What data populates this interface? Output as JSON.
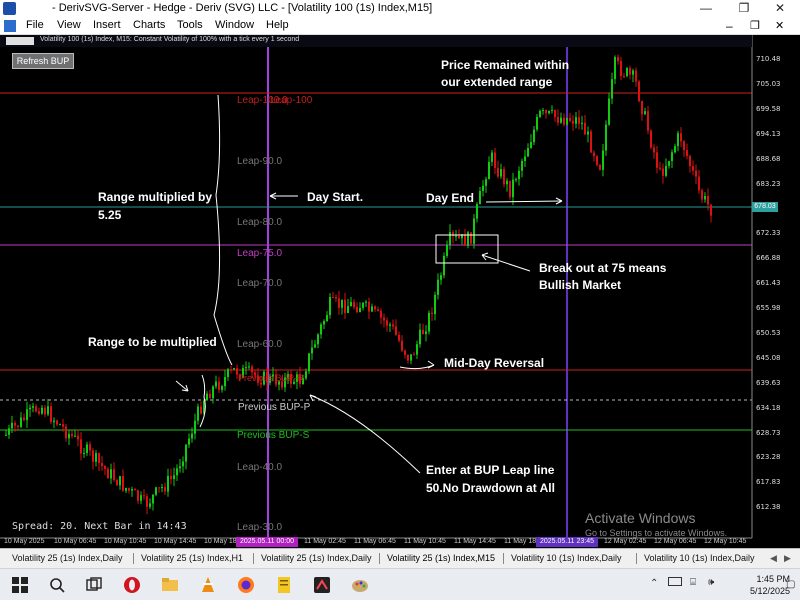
{
  "window": {
    "title": "- DerivSVG-Server - Hedge - Deriv (SVG) LLC - [Volatility 100 (1s) Index,M15]",
    "minimize": "—",
    "restore": "❐",
    "close": "✕"
  },
  "menu": [
    "File",
    "View",
    "Insert",
    "Charts",
    "Tools",
    "Window",
    "Help"
  ],
  "chart": {
    "info": "Volatility 100 (1s) Index, M15:  Constant Volatility of 100% with a tick every 1 second",
    "refresh_label": "Refresh BUP",
    "spread": "Spread: 20. Next Bar in 14:43",
    "current_price": "678.03",
    "axis_prices": [
      "710.48",
      "705.03",
      "699.58",
      "694.13",
      "688.68",
      "683.23",
      "678.03",
      "672.33",
      "666.88",
      "661.43",
      "655.98",
      "650.53",
      "645.08",
      "639.63",
      "634.18",
      "628.73",
      "623.28",
      "617.83",
      "612.38"
    ],
    "time_labels": [
      "10 May 2025",
      "10 May 06:45",
      "10 May 10:45",
      "10 May 14:45",
      "10 May 18",
      "10 May 22:45",
      "11 May 02:45",
      "11 May 06:45",
      "11 May 10:45",
      "11 May 14:45",
      "11 May 18",
      "11 May 22:45",
      "12 May 02:45",
      "12 May 06:45",
      "12 May 10:45"
    ],
    "highlight_time_1": "2025.05.11 00:00",
    "highlight_time_2": "2025.05.11 23:45",
    "levels": [
      {
        "label": "Leap-100.0",
        "color": "#c02020"
      },
      {
        "label": "Leap-100",
        "color": "#c02020"
      },
      {
        "label": "Leap-90.0",
        "color": "#777777"
      },
      {
        "label": "Leap-80.0",
        "color": "#777777"
      },
      {
        "label": "Leap-75.0",
        "color": "#c040c0"
      },
      {
        "label": "Leap-70.0",
        "color": "#777777"
      },
      {
        "label": "Leap-60.0",
        "color": "#777777"
      },
      {
        "label": "Previous BUP-P",
        "color": "#cccccc"
      },
      {
        "label": "Previous BUP-S",
        "color": "#22bb22"
      },
      {
        "label": "Leap-40.0",
        "color": "#777777"
      },
      {
        "label": "Leap-30.0",
        "color": "#777777"
      },
      {
        "label": "Previous BUP-R",
        "color": "#c02020"
      }
    ],
    "annotations": {
      "price_remained_1": "Price Remained within",
      "price_remained_2": "our extended range",
      "range_mult_1": "Range multiplied by",
      "range_mult_2": "5.25",
      "day_start": "Day Start.",
      "day_end": "Day End",
      "breakout_1": "Break out at 75 means",
      "breakout_2": "Bullish Market",
      "range_to_mult": "Range to be multiplied",
      "midday": "Mid-Day Reversal",
      "enter_1": "Enter at BUP Leap line",
      "enter_2": "50.No Drawdown at All"
    },
    "watermark_1": "Activate Windows",
    "watermark_2": "Go to Settings to activate Windows."
  },
  "tabs": [
    "Volatility 25 (1s) Index,Daily",
    "Volatility 25 (1s) Index,H1",
    "Volatility 25 (1s) Index,Daily",
    "Volatility 25 (1s) Index,M15",
    "Volatility 10 (1s) Index,Daily",
    "Volatility 10 (1s) Index,Daily"
  ],
  "taskbar": {
    "time": "1:45 PM",
    "date": "5/12/2025"
  }
}
